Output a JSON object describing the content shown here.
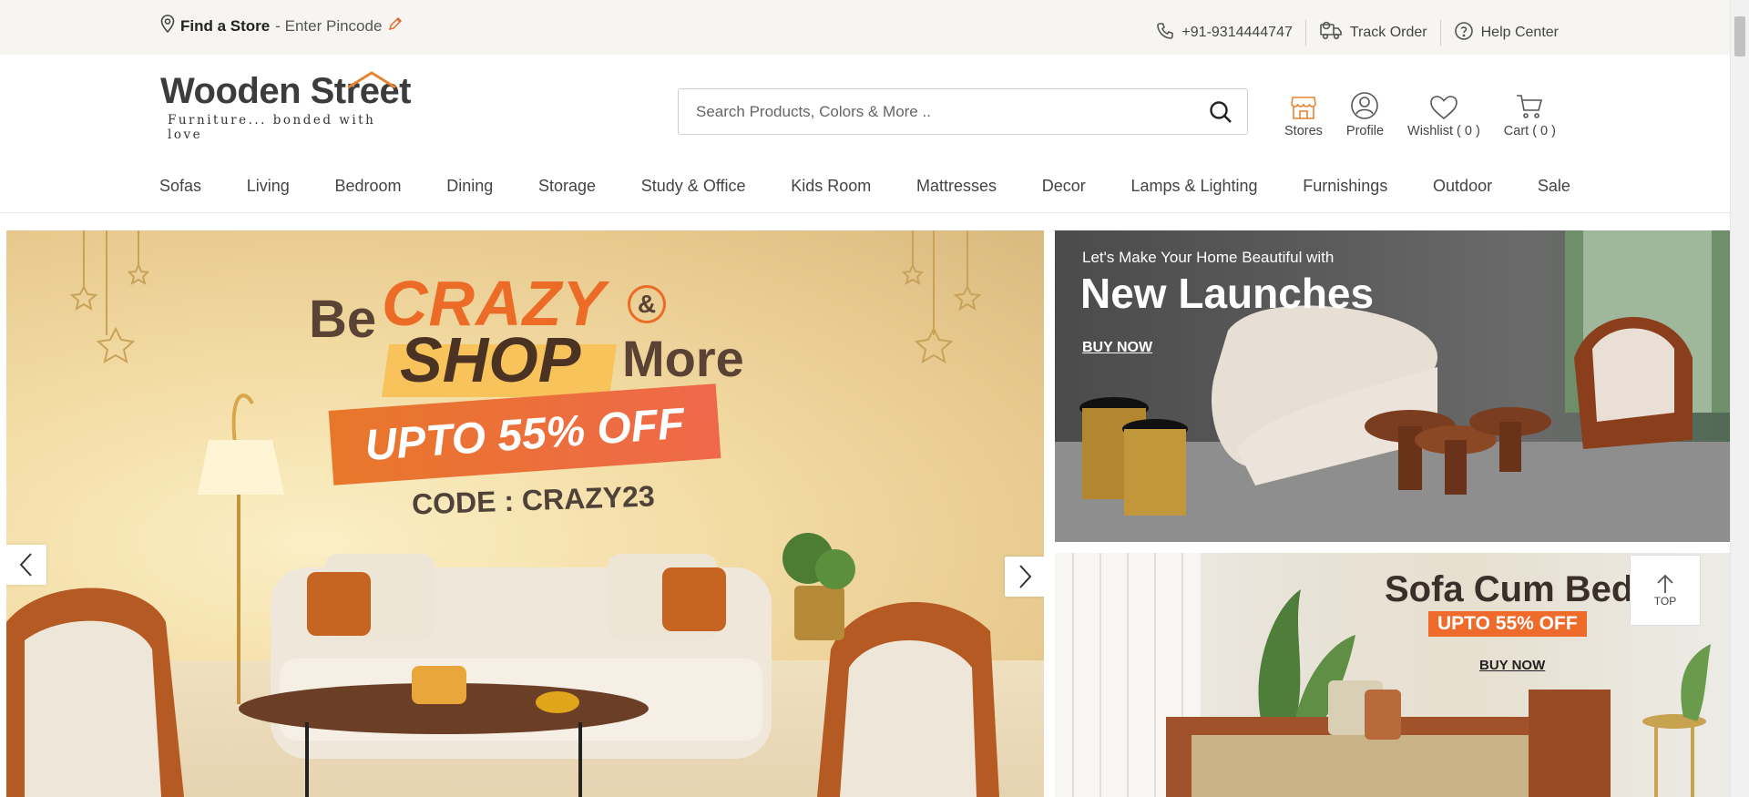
{
  "topbar": {
    "find_store_label": "Find a Store",
    "pincode_label": "- Enter Pincode",
    "phone": "+91-9314444747",
    "track_order": "Track Order",
    "help_center": "Help Center"
  },
  "logo": {
    "name": "Wooden Street",
    "tagline": "Furniture... bonded with love"
  },
  "search": {
    "placeholder": "Search Products, Colors & More .."
  },
  "header_icons": {
    "stores": "Stores",
    "profile": "Profile",
    "wishlist": "Wishlist ( 0 )",
    "cart": "Cart ( 0 )"
  },
  "nav": {
    "items": [
      "Sofas",
      "Living",
      "Bedroom",
      "Dining",
      "Storage",
      "Study & Office",
      "Kids Room",
      "Mattresses",
      "Decor",
      "Lamps & Lighting",
      "Furnishings",
      "Outdoor",
      "Sale"
    ]
  },
  "hero": {
    "be": "Be",
    "crazy": "CRAZY",
    "amp": "&",
    "shop": "SHOP",
    "more": "More",
    "offer": "UPTO 55% OFF",
    "code": "CODE : CRAZY23"
  },
  "banner_new_launches": {
    "subtitle": "Let's Make Your Home Beautiful with",
    "title": "New Launches",
    "cta": "BUY NOW"
  },
  "banner_sofa_cum_bed": {
    "title": "Sofa Cum Bed",
    "offer": "UPTO 55% OFF",
    "cta": "BUY NOW"
  },
  "scroll_top": {
    "label": "TOP"
  },
  "colors": {
    "accent": "#e8832f",
    "offer_orange": "#ee6b2c",
    "topbar_bg": "#f6f5f2"
  }
}
